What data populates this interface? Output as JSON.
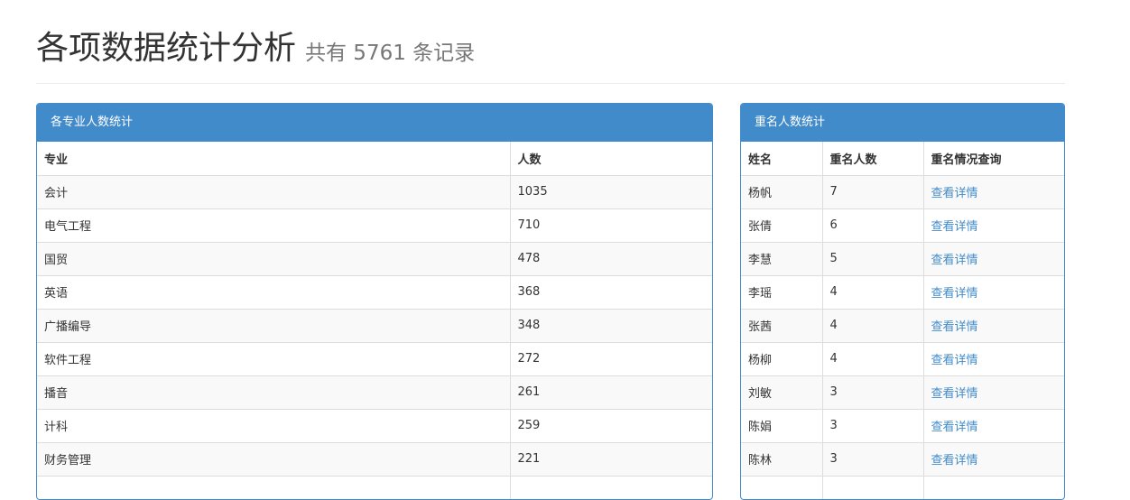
{
  "header": {
    "title": "各项数据统计分析",
    "subtitle": "共有 5761 条记录"
  },
  "major_panel": {
    "title": "各专业人数统计",
    "columns": [
      "专业",
      "人数"
    ],
    "rows": [
      {
        "major": "会计",
        "count": "1035"
      },
      {
        "major": "电气工程",
        "count": "710"
      },
      {
        "major": "国贸",
        "count": "478"
      },
      {
        "major": "英语",
        "count": "368"
      },
      {
        "major": "广播编导",
        "count": "348"
      },
      {
        "major": "软件工程",
        "count": "272"
      },
      {
        "major": "播音",
        "count": "261"
      },
      {
        "major": "计科",
        "count": "259"
      },
      {
        "major": "财务管理",
        "count": "221"
      },
      {
        "major": "",
        "count": ""
      }
    ]
  },
  "duplicate_panel": {
    "title": "重名人数统计",
    "columns": [
      "姓名",
      "重名人数",
      "重名情况查询"
    ],
    "rows": [
      {
        "name": "杨帆",
        "count": "7",
        "link": "查看详情"
      },
      {
        "name": "张倩",
        "count": "6",
        "link": "查看详情"
      },
      {
        "name": "李慧",
        "count": "5",
        "link": "查看详情"
      },
      {
        "name": "李瑶",
        "count": "4",
        "link": "查看详情"
      },
      {
        "name": "张茜",
        "count": "4",
        "link": "查看详情"
      },
      {
        "name": "杨柳",
        "count": "4",
        "link": "查看详情"
      },
      {
        "name": "刘敏",
        "count": "3",
        "link": "查看详情"
      },
      {
        "name": "陈娟",
        "count": "3",
        "link": "查看详情"
      },
      {
        "name": "陈林",
        "count": "3",
        "link": "查看详情"
      },
      {
        "name": "",
        "count": "",
        "link": ""
      }
    ]
  },
  "colors": {
    "panel_primary": "#428bca",
    "link": "#428bca",
    "subtitle": "#777777"
  }
}
